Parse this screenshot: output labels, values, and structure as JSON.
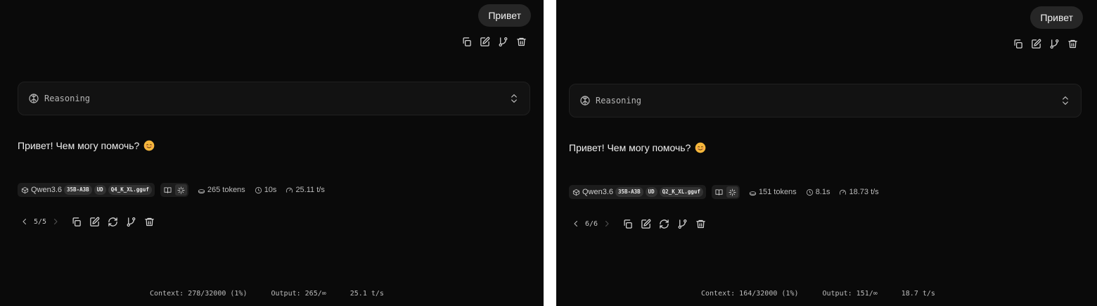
{
  "panels": [
    {
      "user_message": "Привет",
      "reasoning_label": "Reasoning",
      "assistant_text": "Привет! Чем могу помочь?",
      "model_name": "Qwen3.6",
      "model_tags": [
        "35B-A3B",
        "UD",
        "Q4_K_XL.gguf"
      ],
      "tokens": "265 tokens",
      "time": "10s",
      "speed": "25.11 t/s",
      "version": "5/5",
      "footer": {
        "context": "Context: 278/32000 (1%)",
        "output": "Output: 265/∞",
        "speed": "25.1 t/s"
      }
    },
    {
      "user_message": "Привет",
      "reasoning_label": "Reasoning",
      "assistant_text": "Привет! Чем могу помочь?",
      "model_name": "Qwen3.6",
      "model_tags": [
        "35B-A3B",
        "UD",
        "Q2_K_XL.gguf"
      ],
      "tokens": "151 tokens",
      "time": "8.1s",
      "speed": "18.73 t/s",
      "version": "6/6",
      "footer": {
        "context": "Context: 164/32000 (1%)",
        "output": "Output: 151/∞",
        "speed": "18.7 t/s"
      }
    }
  ],
  "icons": {
    "user_actions": [
      "copy-icon",
      "edit-icon",
      "branch-icon",
      "trash-icon"
    ],
    "assistant_actions": [
      "copy-icon",
      "edit-icon",
      "refresh-icon",
      "branch-icon",
      "trash-icon"
    ],
    "reasoning": "brain-icon",
    "emoji": "smiling-face-emoji"
  }
}
